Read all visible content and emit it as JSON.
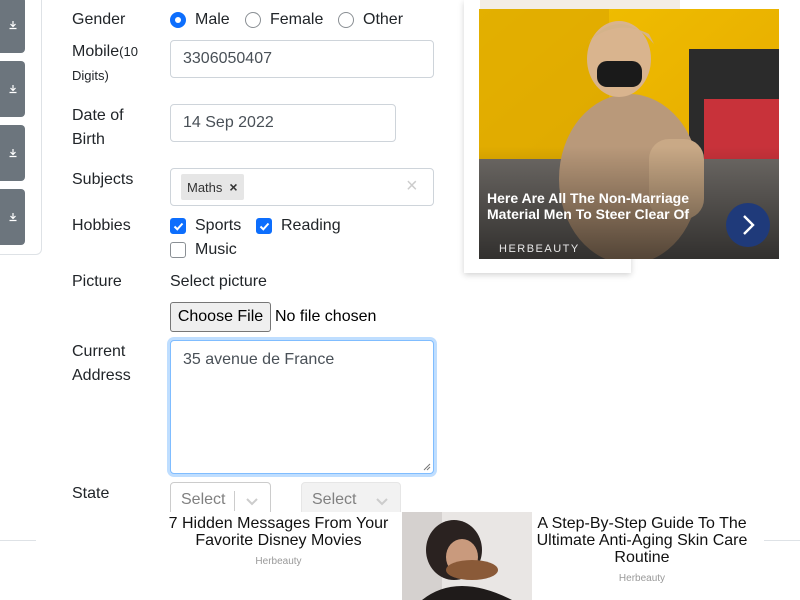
{
  "form": {
    "gender": {
      "label": "Gender",
      "options": [
        {
          "label": "Male",
          "checked": true
        },
        {
          "label": "Female",
          "checked": false
        },
        {
          "label": "Other",
          "checked": false
        }
      ]
    },
    "mobile": {
      "label": "Mobile",
      "hint_line1": "(10",
      "hint_line2": "Digits)",
      "value": "3306050407"
    },
    "dob": {
      "label_line1": "Date of",
      "label_line2": "Birth",
      "value": "14 Sep 2022"
    },
    "subjects": {
      "label": "Subjects",
      "chips": [
        "Maths"
      ],
      "chip_remove": "×",
      "clear": "×"
    },
    "hobbies": {
      "label": "Hobbies",
      "options": [
        {
          "label": "Sports",
          "checked": true
        },
        {
          "label": "Reading",
          "checked": true
        },
        {
          "label": "Music",
          "checked": false
        }
      ]
    },
    "picture": {
      "label": "Picture",
      "caption": "Select picture",
      "button": "Choose File",
      "status": "No file chosen"
    },
    "address": {
      "label_line1": "Current",
      "label_line2": "Address",
      "value": "35 avenue de France"
    },
    "state": {
      "label": "State",
      "placeholder": "Select State"
    },
    "city": {
      "placeholder": "Select City"
    }
  },
  "ad_side": {
    "headline": "Here Are All The Non-Marriage Material Men To Steer Clear Of",
    "brand": "HERBEAUTY",
    "next_icon": "chevron-right-icon"
  },
  "ad_bottom": {
    "left": {
      "title": "7 Hidden Messages From Your Favorite Disney Movies",
      "source": "Herbeauty"
    },
    "right": {
      "title": "A Step-By-Step Guide To The Ultimate Anti-Aging Skin Care Routine",
      "source": "Herbeauty"
    }
  },
  "colors": {
    "accent": "#0d6efd",
    "sidebar_button": "#6c757d",
    "ad_button": "#1f3a7a"
  }
}
